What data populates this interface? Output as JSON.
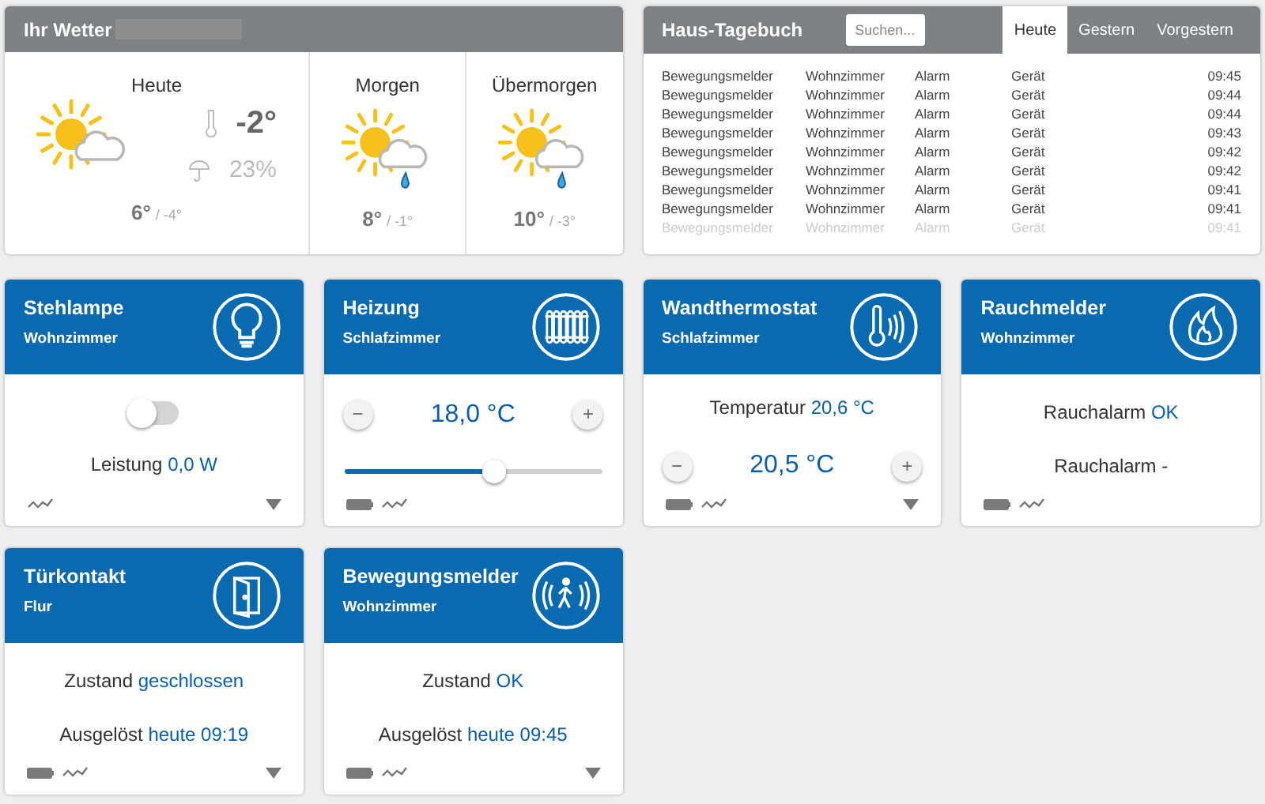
{
  "weather": {
    "title": "Ihr Wetter",
    "location_redacted": true,
    "today": {
      "label": "Heute",
      "kind": "partly_cloudy",
      "current": "-2°",
      "rain": "23%",
      "high": "6°",
      "low": "/ -4°"
    },
    "days": [
      {
        "label": "Morgen",
        "kind": "rain",
        "high": "8°",
        "low": "/ -1°"
      },
      {
        "label": "Übermorgen",
        "kind": "rain",
        "high": "10°",
        "low": "/ -3°"
      }
    ]
  },
  "journal": {
    "title": "Haus-Tagebuch",
    "search": {
      "placeholder": "Suchen..."
    },
    "tabs": [
      {
        "label": "Heute",
        "selected": true
      },
      {
        "label": "Gestern",
        "selected": false
      },
      {
        "label": "Vorgestern",
        "selected": false
      }
    ],
    "rows": [
      {
        "cells": [
          "Bewegungsmelder",
          "Wohnzimmer",
          "Alarm",
          "Gerät",
          "09:45"
        ],
        "faded": false
      },
      {
        "cells": [
          "Bewegungsmelder",
          "Wohnzimmer",
          "Alarm",
          "Gerät",
          "09:44"
        ],
        "faded": false
      },
      {
        "cells": [
          "Bewegungsmelder",
          "Wohnzimmer",
          "Alarm",
          "Gerät",
          "09:44"
        ],
        "faded": false
      },
      {
        "cells": [
          "Bewegungsmelder",
          "Wohnzimmer",
          "Alarm",
          "Gerät",
          "09:43"
        ],
        "faded": false
      },
      {
        "cells": [
          "Bewegungsmelder",
          "Wohnzimmer",
          "Alarm",
          "Gerät",
          "09:42"
        ],
        "faded": false
      },
      {
        "cells": [
          "Bewegungsmelder",
          "Wohnzimmer",
          "Alarm",
          "Gerät",
          "09:42"
        ],
        "faded": false
      },
      {
        "cells": [
          "Bewegungsmelder",
          "Wohnzimmer",
          "Alarm",
          "Gerät",
          "09:41"
        ],
        "faded": false
      },
      {
        "cells": [
          "Bewegungsmelder",
          "Wohnzimmer",
          "Alarm",
          "Gerät",
          "09:41"
        ],
        "faded": false
      },
      {
        "cells": [
          "Bewegungsmelder",
          "Wohnzimmer",
          "Alarm",
          "Gerät",
          "09:41"
        ],
        "faded": true
      }
    ]
  },
  "devices": [
    {
      "kind": "lamp",
      "title": "Stehlampe",
      "room": "Wohnzimmer",
      "battery": false,
      "dropdown": true,
      "rows": [
        {
          "kind": "toggle",
          "on": false
        },
        {
          "kind": "reading",
          "label": "Leistung",
          "value": "0,0 W"
        }
      ]
    },
    {
      "kind": "heating",
      "title": "Heizung",
      "room": "Schlafzimmer",
      "battery": true,
      "dropdown": false,
      "rows": [
        {
          "kind": "stepper",
          "minus": "−",
          "value": "18,0 °C",
          "plus": "+"
        },
        {
          "kind": "slider",
          "level": 0.58
        }
      ]
    },
    {
      "kind": "thermostat",
      "title": "Wandthermostat",
      "room": "Schlafzimmer",
      "battery": true,
      "dropdown": true,
      "rows": [
        {
          "kind": "reading",
          "label": "Temperatur",
          "value": "20,6 °C"
        },
        {
          "kind": "stepper",
          "minus": "−",
          "value": "20,5 °C",
          "plus": "+"
        }
      ]
    },
    {
      "kind": "smoke",
      "title": "Rauchmelder",
      "room": "Wohnzimmer",
      "battery": true,
      "dropdown": false,
      "rows": [
        {
          "kind": "reading",
          "label": "Rauchalarm",
          "value": "OK"
        },
        {
          "kind": "reading",
          "label": "Rauchalarm -"
        }
      ]
    },
    {
      "kind": "door",
      "title": "Türkontakt",
      "room": "Flur",
      "battery": true,
      "dropdown": true,
      "rows": [
        {
          "kind": "reading",
          "label": "Zustand",
          "value": "geschlossen"
        },
        {
          "kind": "reading",
          "label": "Ausgelöst",
          "value": "heute 09:19"
        }
      ]
    },
    {
      "kind": "motion",
      "title": "Bewegungsmelder",
      "room": "Wohnzimmer",
      "battery": true,
      "dropdown": true,
      "rows": [
        {
          "kind": "reading",
          "label": "Zustand",
          "value": "OK"
        },
        {
          "kind": "reading",
          "label": "Ausgelöst",
          "value": "heute 09:45"
        }
      ]
    }
  ]
}
